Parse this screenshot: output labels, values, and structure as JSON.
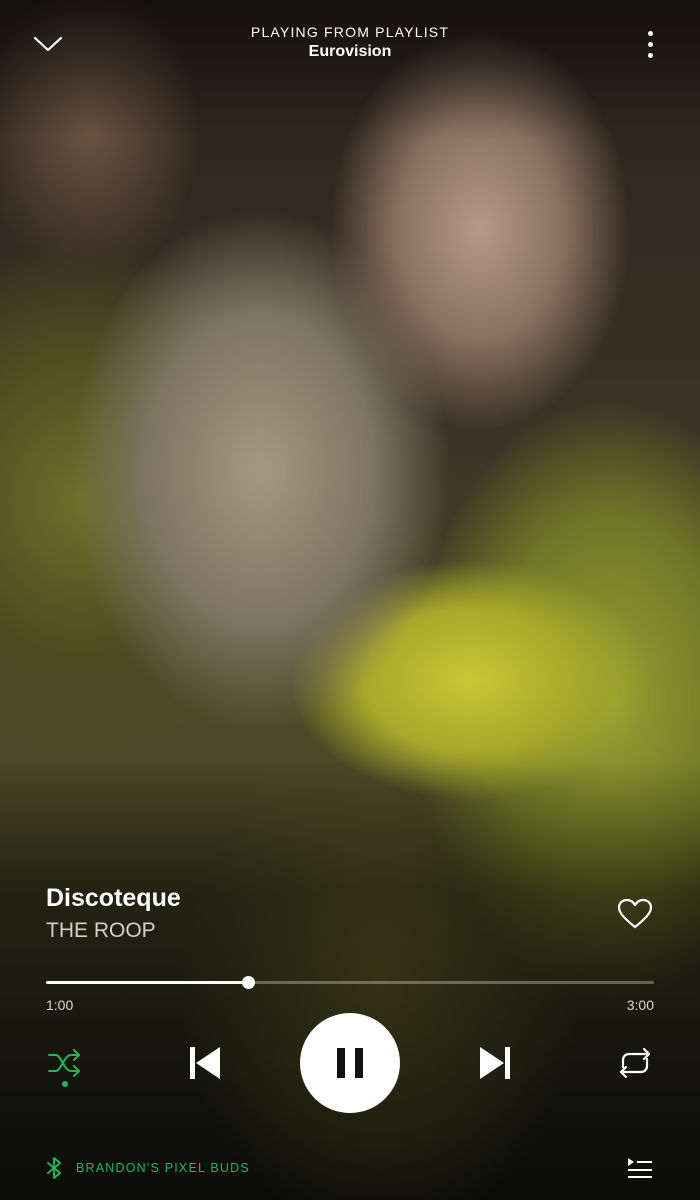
{
  "header": {
    "context_label": "PLAYING FROM PLAYLIST",
    "playlist_name": "Eurovision",
    "collapse_icon": "chevron-down-icon",
    "menu_icon": "more-vertical-icon"
  },
  "track": {
    "title": "Discoteque",
    "artist": "THE ROOP",
    "liked": false
  },
  "playback": {
    "elapsed": "1:00",
    "total": "3:00",
    "progress_fraction": 0.333,
    "is_playing": true,
    "shuffle_on": true,
    "repeat_on": false
  },
  "footer": {
    "device_name": "BRANDON'S PIXEL BUDS",
    "device_icon": "bluetooth-icon",
    "queue_icon": "queue-icon"
  },
  "colors": {
    "accent": "#1db954",
    "text_primary": "#ffffff",
    "text_secondary": "#d0d0cc"
  }
}
